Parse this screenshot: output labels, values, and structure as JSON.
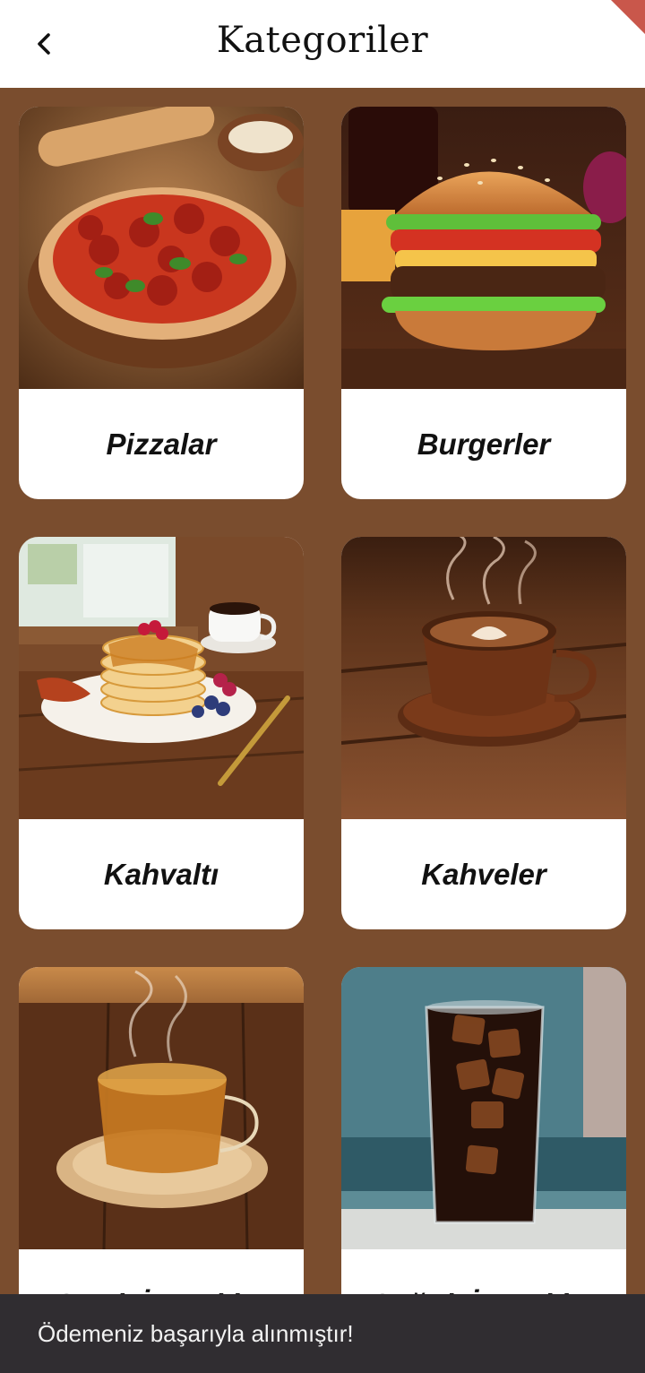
{
  "appbar": {
    "title": "Kategoriler",
    "back_icon": "arrow-back-icon"
  },
  "categories": [
    {
      "label": "Pizzalar",
      "image": "pizza-photo"
    },
    {
      "label": "Burgerler",
      "image": "burger-photo"
    },
    {
      "label": "Kahvaltı",
      "image": "pancake-breakfast-photo"
    },
    {
      "label": "Kahveler",
      "image": "latte-coffee-photo"
    },
    {
      "label": "Sıcak İçecekler",
      "image": "hot-tea-photo"
    },
    {
      "label": "Soğuk İçecekler",
      "image": "iced-cola-photo"
    }
  ],
  "snackbar": {
    "message": "Ödemeniz başarıyla alınmıştır!"
  },
  "colors": {
    "background": "#7a4d2e",
    "card": "#ffffff",
    "snackbar": "#302d31"
  }
}
